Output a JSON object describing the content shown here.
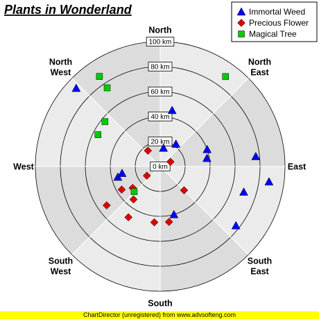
{
  "chart_data": {
    "type": "polar_scatter",
    "title": "Plants in Wonderland",
    "radial_axis": {
      "min": 0,
      "max": 100,
      "step": 20,
      "unit": "km",
      "tick_labels": [
        "0 km",
        "20 km",
        "40 km",
        "60 km",
        "80 km",
        "100 km"
      ]
    },
    "angular_labels": [
      {
        "angle": 0,
        "label": "North"
      },
      {
        "angle": 45,
        "label": "North East"
      },
      {
        "angle": 90,
        "label": "East"
      },
      {
        "angle": 135,
        "label": "South East"
      },
      {
        "angle": 180,
        "label": "South"
      },
      {
        "angle": 225,
        "label": "South West"
      },
      {
        "angle": 270,
        "label": "West"
      },
      {
        "angle": 315,
        "label": "North West"
      }
    ],
    "legend_position": "top-right",
    "series": [
      {
        "name": "Immortal Weed",
        "marker": "triangle",
        "color": "#0000ff",
        "points": [
          {
            "angle": 313,
            "r": 92
          },
          {
            "angle": 12,
            "r": 46
          },
          {
            "angle": 35,
            "r": 22
          },
          {
            "angle": 80,
            "r": 38
          },
          {
            "angle": 70,
            "r": 40
          },
          {
            "angle": 84,
            "r": 77
          },
          {
            "angle": 98,
            "r": 88
          },
          {
            "angle": 107,
            "r": 70
          },
          {
            "angle": 128,
            "r": 77
          },
          {
            "angle": 164,
            "r": 40
          },
          {
            "angle": 10,
            "r": 15
          },
          {
            "angle": 256,
            "r": 35
          },
          {
            "angle": 260,
            "r": 31
          }
        ]
      },
      {
        "name": "Precious Flower",
        "marker": "diamond",
        "color": "#dd0000",
        "points": [
          {
            "angle": 66,
            "r": 9
          },
          {
            "angle": 322,
            "r": 16
          },
          {
            "angle": 235,
            "r": 13
          },
          {
            "angle": 135,
            "r": 27
          },
          {
            "angle": 239,
            "r": 36
          },
          {
            "angle": 219,
            "r": 34
          },
          {
            "angle": 234,
            "r": 53
          },
          {
            "angle": 212,
            "r": 48
          },
          {
            "angle": 186,
            "r": 45
          },
          {
            "angle": 232,
            "r": 28
          },
          {
            "angle": 171,
            "r": 45
          }
        ]
      },
      {
        "name": "Magical Tree",
        "marker": "square",
        "color": "#00cc00",
        "points": [
          {
            "angle": 326,
            "r": 87
          },
          {
            "angle": 326,
            "r": 76
          },
          {
            "angle": 36,
            "r": 89
          },
          {
            "angle": 309,
            "r": 57
          },
          {
            "angle": 297,
            "r": 56
          },
          {
            "angle": 226,
            "r": 29
          }
        ]
      }
    ]
  },
  "footer": "ChartDirector (unregistered) from www.advsofteng.com"
}
